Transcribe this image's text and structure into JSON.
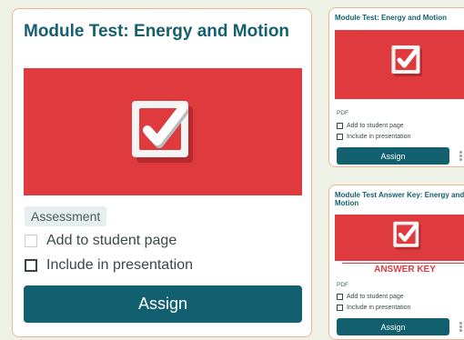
{
  "colors": {
    "brand": "#12606f",
    "title": "#155f6f",
    "accent": "#df3b3f",
    "card_border": "#f0b48f",
    "background": "#eef2e6"
  },
  "main_card": {
    "title": "Module Test: Energy and Motion",
    "thumbnail_icon": "checkbox-check-icon",
    "tag": "Assessment",
    "add_to_student_page": {
      "label": "Add to student page",
      "checked": false
    },
    "include_in_presentation": {
      "label": "Include in presentation",
      "checked": false
    },
    "assign_label": "Assign"
  },
  "side_cards": [
    {
      "title": "Module Test: Energy and Motion",
      "thumbnail_icon": "checkbox-check-icon",
      "tag": "PDF",
      "add_to_student_page": "Add to student page",
      "include_in_presentation": "Include in presentation",
      "assign_label": "Assign",
      "more_icon": "more-vertical-icon"
    },
    {
      "title": "Module Test Answer Key: Energy and Motion",
      "thumbnail_icon": "checkbox-check-icon",
      "thumbnail_banner": "ANSWER KEY",
      "tag": "PDF",
      "add_to_student_page": "Add to student page",
      "include_in_presentation": "Include in presentation",
      "assign_label": "Assign",
      "more_icon": "more-vertical-icon"
    }
  ]
}
